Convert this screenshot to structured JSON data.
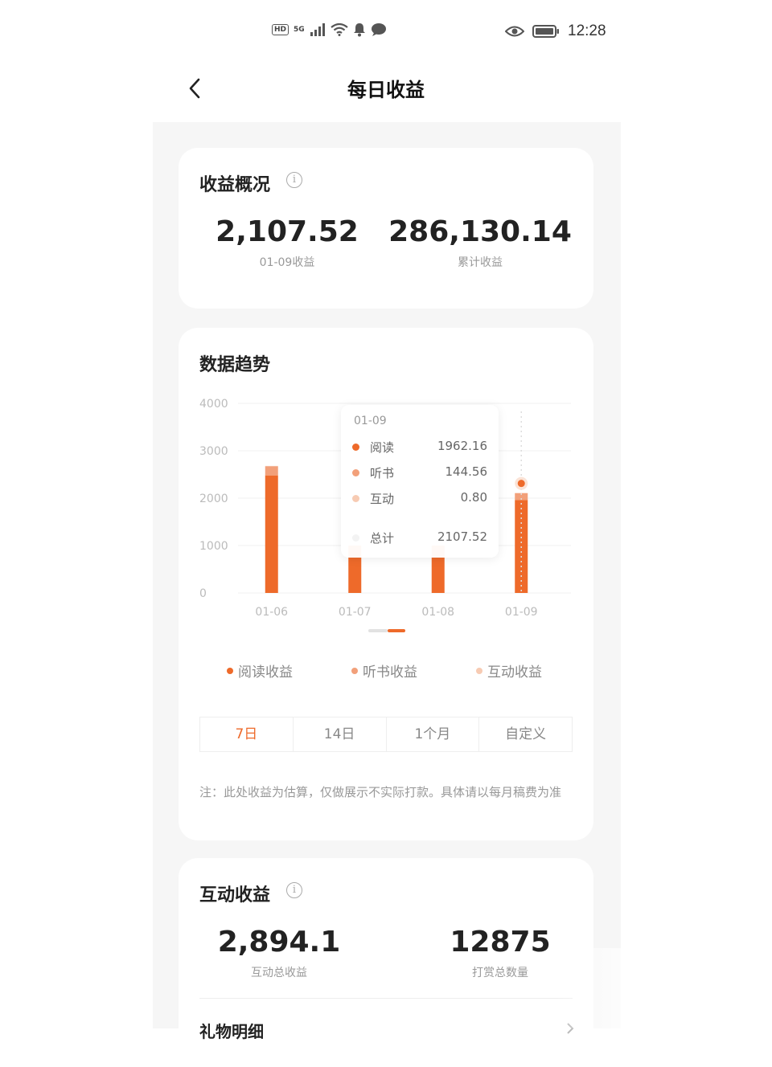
{
  "status_bar": {
    "hd": "HD",
    "network": "5G",
    "time": "12:28"
  },
  "header": {
    "title": "每日收益"
  },
  "overview": {
    "title": "收益概况",
    "daily_value": "2,107.52",
    "daily_label": "01-09收益",
    "total_value": "286,130.14",
    "total_label": "累计收益"
  },
  "trend": {
    "title": "数据趋势",
    "tooltip": {
      "date": "01-09",
      "rows": [
        {
          "name": "阅读",
          "value": "1962.16",
          "color": "#ee6a2a"
        },
        {
          "name": "听书",
          "value": "144.56",
          "color": "#f2a07a"
        },
        {
          "name": "互动",
          "value": "0.80",
          "color": "#f7cbb3"
        }
      ],
      "total_name": "总计",
      "total_value": "2107.52"
    },
    "legend": [
      {
        "label": "阅读收益",
        "color": "#ee6a2a"
      },
      {
        "label": "听书收益",
        "color": "#f2a07a"
      },
      {
        "label": "互动收益",
        "color": "#f7cbb3"
      }
    ],
    "ranges": [
      "7日",
      "14日",
      "1个月",
      "自定义"
    ],
    "active_range": "7日",
    "note": "注：此处收益为估算，仅做展示不实际打款。具体请以每月稿费为准"
  },
  "chart_data": {
    "type": "bar",
    "stacked": true,
    "categories": [
      "01-06",
      "01-07",
      "01-08",
      "01-09"
    ],
    "series": [
      {
        "name": "阅读收益",
        "color": "#ee6a2a",
        "values": [
          2480,
          1000,
          1000,
          1962.16
        ]
      },
      {
        "name": "听书收益",
        "color": "#f2a07a",
        "values": [
          190,
          0,
          0,
          144.56
        ]
      },
      {
        "name": "互动收益",
        "color": "#f7cbb3",
        "values": [
          10,
          0,
          0,
          0.8
        ]
      }
    ],
    "yticks": [
      0,
      1000,
      2000,
      3000,
      4000
    ],
    "ylim": [
      0,
      4000
    ],
    "grid": true,
    "legend_position": "bottom"
  },
  "interaction": {
    "title": "互动收益",
    "total_value": "2,894.1",
    "total_label": "互动总收益",
    "count_value": "12875",
    "count_label": "打赏总数量",
    "next_row_partial": "礼物明细"
  }
}
